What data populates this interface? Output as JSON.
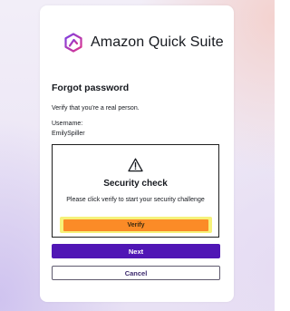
{
  "brand": {
    "name": "Amazon Quick Suite",
    "logo_icon": "quick-suite-hexagon-logo"
  },
  "form": {
    "title": "Forgot password",
    "verify_text": "Verify that you're a real person.",
    "username_label": "Username:",
    "username_value": "EmilySpiller"
  },
  "captcha": {
    "icon": "warning-triangle-icon",
    "title": "Security check",
    "description": "Please click verify to start your security challenge",
    "verify_label": "Verify"
  },
  "buttons": {
    "next_label": "Next",
    "cancel_label": "Cancel"
  },
  "colors": {
    "primary": "#5016b5",
    "verify_button": "#fb8b27",
    "verify_highlight": "#f6f27a",
    "logo_gradient_start": "#7b3fe4",
    "logo_gradient_end": "#e0348a"
  }
}
